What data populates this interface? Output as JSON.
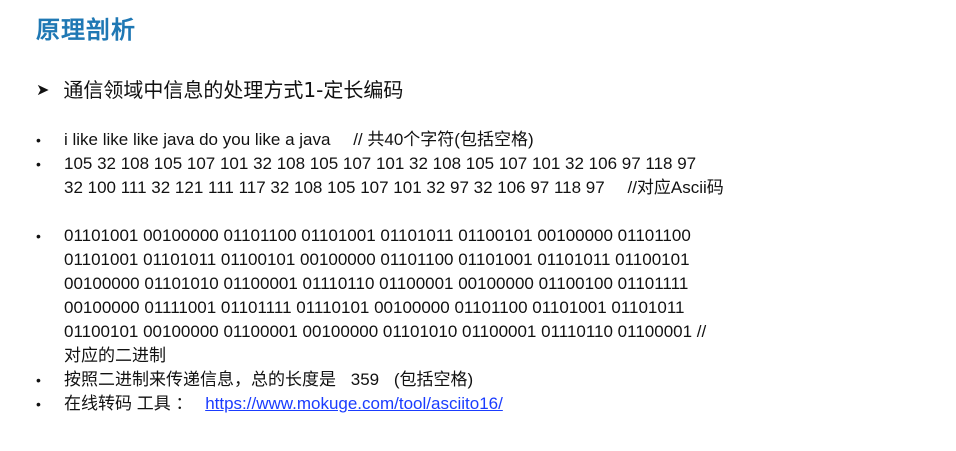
{
  "title": "原理剖析",
  "subtitle": "通信领域中信息的处理方式1-定长编码",
  "bullets": {
    "sentence": "i like like like java do you like a java",
    "sentence_note": "// 共40个字符(包括空格)",
    "ascii_line1": "105 32 108 105 107 101 32 108 105 107 101 32 108 105 107 101 32 106 97 118 97",
    "ascii_line2": "32 100 111 32 121 111 117 32 108 105 107 101 32 97 32 106 97 118 97",
    "ascii_note": "//对应Ascii码",
    "binary_line1": "01101001 00100000 01101100 01101001 01101011 01100101 00100000 01101100",
    "binary_line2": "01101001 01101011 01100101 00100000 01101100 01101001 01101011 01100101",
    "binary_line3": "00100000 01101010 01100001 01110110 01100001 00100000 01100100 01101111",
    "binary_line4": "00100000 01111001 01101111 01110101 00100000 01101100 01101001 01101011",
    "binary_line5": "01100101 00100000 01100001 00100000 01101010 01100001 01110110 01100001 //",
    "binary_line6": "对应的二进制",
    "length_prefix": "按照二进制来传递信息，总的长度是",
    "length_value": "359",
    "length_suffix": "(包括空格)",
    "tool_label": "在线转码 工具 ：",
    "tool_link": "https://www.mokuge.com/tool/asciito16/"
  }
}
